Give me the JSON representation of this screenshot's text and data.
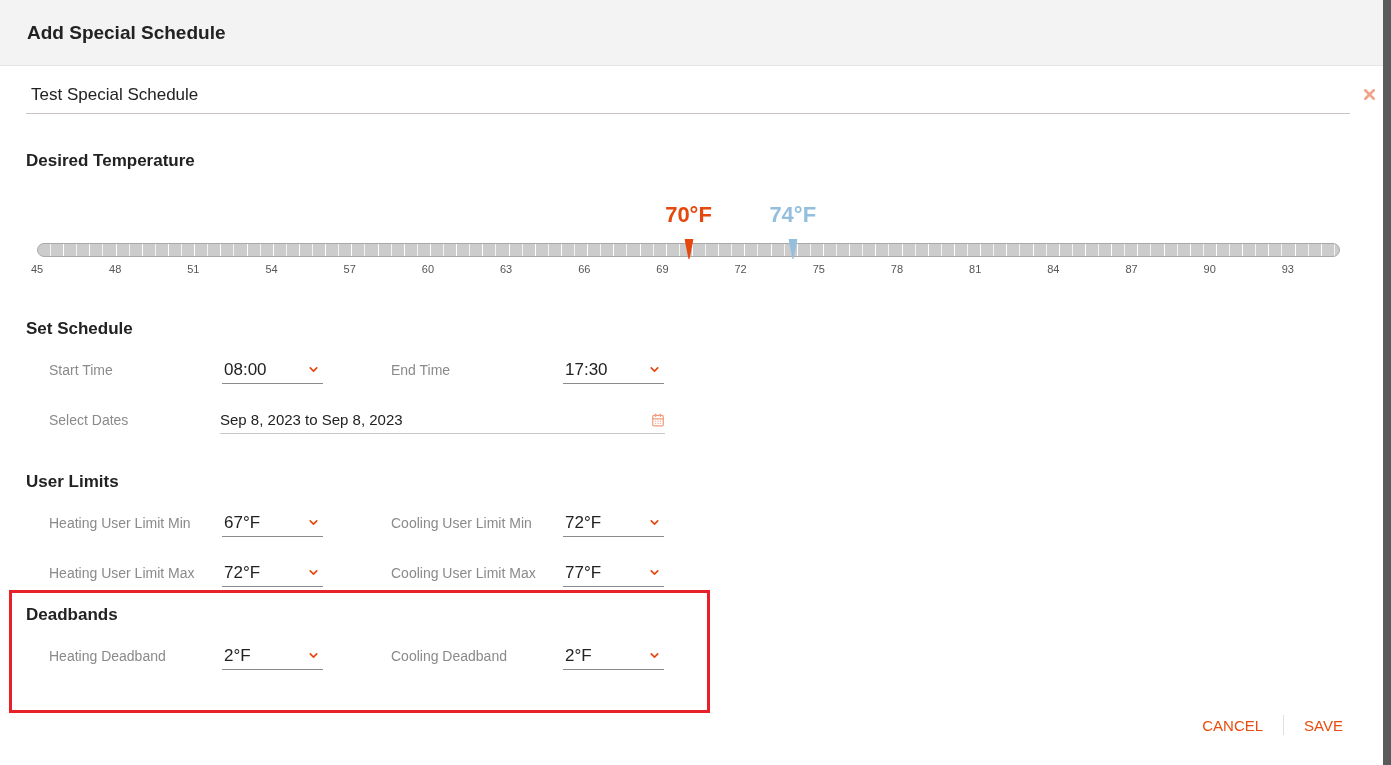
{
  "dialog": {
    "title": "Add Special Schedule",
    "name_field": {
      "value": "Test Special Schedule"
    },
    "sections": [
      {
        "kind": "slider",
        "heading": "Desired Temperature",
        "highlighted": false,
        "thumbs": [
          {
            "reading": "70°F",
            "level": 0.5,
            "color": "#e5470f"
          },
          {
            "reading": "74°F",
            "level": 0.58,
            "color": "#93bfdc"
          }
        ],
        "scale": [
          "45",
          "48",
          "51",
          "54",
          "57",
          "60",
          "63",
          "66",
          "69",
          "72",
          "75",
          "78",
          "81",
          "84",
          "87",
          "90",
          "93"
        ]
      },
      {
        "kind": "fields",
        "heading": "Set Schedule",
        "highlighted": false,
        "rows": [
          {
            "fields": [
              {
                "kind": "select",
                "label": "Start Time",
                "value": "08:00"
              },
              {
                "kind": "select",
                "label": "End Time",
                "value": "17:30"
              }
            ]
          },
          {
            "fields": [
              {
                "kind": "date",
                "label": "Select Dates",
                "value": "Sep 8, 2023 to Sep 8, 2023"
              }
            ]
          }
        ]
      },
      {
        "kind": "fields",
        "heading": "User Limits",
        "highlighted": false,
        "rows": [
          {
            "fields": [
              {
                "kind": "select",
                "label": "Heating User Limit Min",
                "value": "67°F"
              },
              {
                "kind": "select",
                "label": "Cooling User Limit Min",
                "value": "72°F"
              }
            ]
          },
          {
            "fields": [
              {
                "kind": "select",
                "label": "Heating User Limit Max",
                "value": "72°F"
              },
              {
                "kind": "select",
                "label": "Cooling User Limit Max",
                "value": "77°F"
              }
            ]
          }
        ]
      },
      {
        "kind": "fields",
        "heading": "Deadbands",
        "highlighted": true,
        "rows": [
          {
            "fields": [
              {
                "kind": "select",
                "label": "Heating Deadband",
                "value": "2°F"
              },
              {
                "kind": "select",
                "label": "Cooling Deadband",
                "value": "2°F"
              }
            ]
          }
        ]
      }
    ],
    "buttons": [
      "CANCEL",
      "SAVE"
    ]
  }
}
